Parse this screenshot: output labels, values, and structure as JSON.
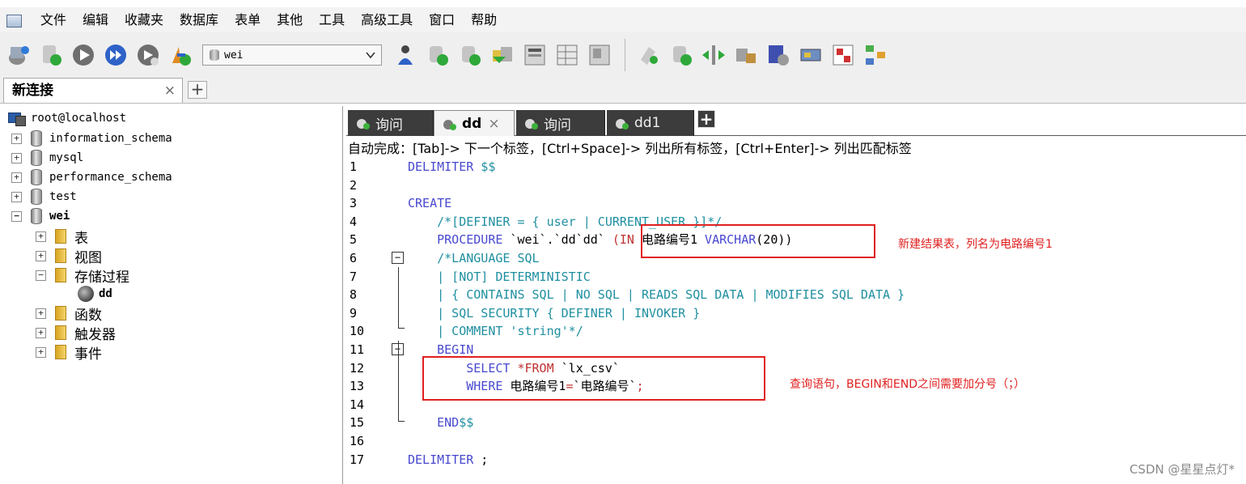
{
  "menubar": {
    "items": [
      "文件",
      "编辑",
      "收藏夹",
      "数据库",
      "表单",
      "其他",
      "工具",
      "高级工具",
      "窗口",
      "帮助"
    ]
  },
  "toolbar": {
    "database_select": {
      "value": "wei"
    },
    "icons": [
      "new-connection-icon",
      "connect-icon",
      "execute-query-icon",
      "execute-all-icon",
      "stop-icon",
      "user-manager-icon",
      "database-icon",
      "user-icon",
      "create-database-icon",
      "create-table-icon",
      "copy-icon",
      "table-data-icon",
      "grid-icon",
      "schema-icon",
      "backup-icon",
      "import-icon",
      "sync-icon",
      "compare-icon",
      "scheduler-icon",
      "notifications-icon",
      "report-icon",
      "query-builder-icon"
    ]
  },
  "connection_tab": {
    "label": "新连接",
    "close": "×",
    "add": "+"
  },
  "tree": {
    "root": "root@localhost",
    "databases": [
      "information_schema",
      "mysql",
      "performance_schema",
      "test",
      "wei"
    ],
    "wei_children": [
      "表",
      "视图",
      "存储过程",
      "函数",
      "触发器",
      "事件"
    ],
    "procedure": "dd",
    "collapsed_symbol": "+",
    "expanded_symbol": "−"
  },
  "query_tabs": [
    {
      "label": "询问",
      "active": false
    },
    {
      "label": "dd",
      "active": true,
      "close": "×"
    },
    {
      "label": "询问",
      "active": false
    },
    {
      "label": "dd1",
      "active": false
    }
  ],
  "query_tab_add": "+",
  "autocomplete_hint": "自动完成：[Tab]-> 下一个标签，[Ctrl+Space]-> 列出所有标签，[Ctrl+Enter]-> 列出匹配标签",
  "code": {
    "line_numbers": [
      "1",
      "2",
      "3",
      "4",
      "5",
      "6",
      "7",
      "8",
      "9",
      "10",
      "11",
      "12",
      "13",
      "14",
      "15",
      "16",
      "17"
    ],
    "l1_kw": "DELIMITER",
    "l1_rest": " $$",
    "l3_kw": "CREATE",
    "l4": "    /*[DEFINER = { user | CURRENT_USER }]*/",
    "l5_kw": "    PROCEDURE",
    "l5_name": " `wei`.`dd`dd` ",
    "l5_paren": "(IN ",
    "l5_param": "电路编号1",
    "l5_type": " VARCHAR",
    "l5_len": "(20))",
    "l6": "    /*LANGUAGE SQL",
    "l7": "    | [NOT] DETERMINISTIC",
    "l8": "    | { CONTAINS SQL | NO SQL | READS SQL DATA | MODIFIES SQL DATA }",
    "l9": "    | SQL SECURITY { DEFINER | INVOKER }",
    "l10": "    | COMMENT 'string'*/",
    "l11_kw": "    BEGIN",
    "l12_kw": "        SELECT",
    "l12_op": " *FROM ",
    "l12_tbl": "`lx_csv`",
    "l13_kw": "        WHERE",
    "l13_a": " 电路编号1",
    "l13_eq": "=",
    "l13_b": "`电路编号`",
    "l13_semi": ";",
    "l15_kw": "    END",
    "l15_rest": "$$",
    "l17_kw": "DELIMITER",
    "l17_rest": " ;",
    "fold_symbol": "−"
  },
  "annotations": {
    "note1": "新建结果表，列名为电路编号1",
    "note2": "查询语句，BEGIN和END之间需要加分号（；）"
  },
  "watermark": "CSDN @星星点灯*",
  "colors": {
    "keyword": "#4848d0",
    "comment": "#1f8fa0",
    "annotation": "#e02020",
    "tab_dark": "#3c3c3c"
  }
}
